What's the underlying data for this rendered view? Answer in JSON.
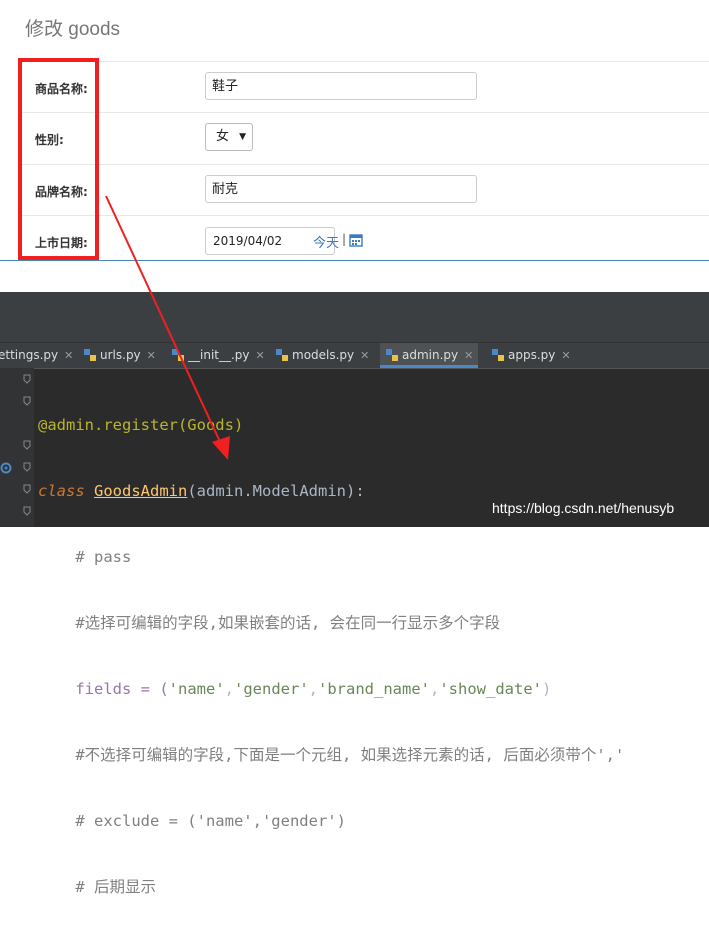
{
  "admin": {
    "title": "修改 goods",
    "fields": {
      "name": {
        "label": "商品名称:",
        "value": "鞋子"
      },
      "gender": {
        "label": "性别:",
        "value": "女"
      },
      "brand": {
        "label": "品牌名称:",
        "value": "耐克"
      },
      "date": {
        "label": "上市日期:",
        "value": "2019/04/02",
        "today": "今天",
        "sep": "|"
      }
    }
  },
  "ide": {
    "tabs": [
      {
        "label": "ettings.py"
      },
      {
        "label": "urls.py"
      },
      {
        "label": "__init__.py"
      },
      {
        "label": "models.py"
      },
      {
        "label": "admin.py"
      },
      {
        "label": "apps.py"
      }
    ],
    "active_tab": "admin.py",
    "code": {
      "l1": "@admin.register(Goods)",
      "l2_kw": "class",
      "l2_cls": "GoodsAdmin",
      "l2_rest": "(admin.ModelAdmin):",
      "l3": "    # pass",
      "l4": "    #选择可编辑的字段,如果嵌套的话, 会在同一行显示多个字段",
      "l5_a": "    fields = (",
      "l5_s1": "'name'",
      "l5_s2": "'gender'",
      "l5_s3": "'brand_name'",
      "l5_s4": "'show_date'",
      "l5_end": ")",
      "l6": "    #不选择可编辑的字段,下面是一个元组, 如果选择元素的话, 后面必须带个','",
      "l7": "    # exclude = ('name','gender')",
      "l8": "    # 后期显示"
    },
    "watermark": "https://blog.csdn.net/henusyb"
  },
  "colors": {
    "highlight_box": "#f02020",
    "arrow": "#f02020",
    "editor_bg": "#2b2b2b"
  }
}
